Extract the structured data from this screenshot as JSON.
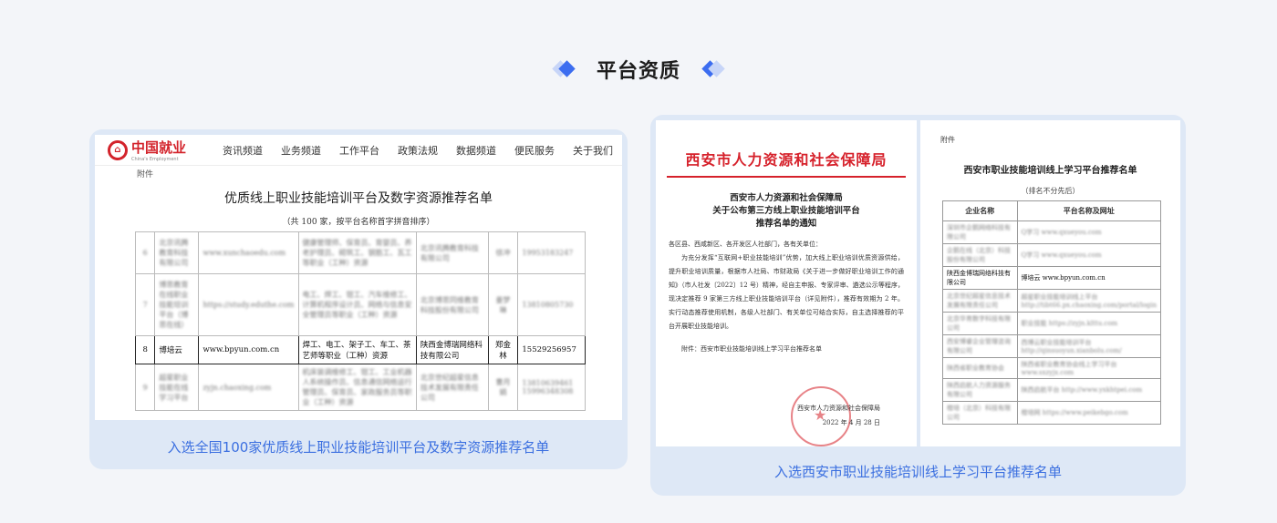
{
  "section": {
    "title": "平台资质"
  },
  "card1": {
    "nav": {
      "logo_text": "中国就业",
      "logo_sub": "China's Employment",
      "items": [
        "资讯频道",
        "业务频道",
        "工作平台",
        "政策法规",
        "数据频道",
        "便民服务",
        "关于我们"
      ]
    },
    "attachment": "附件",
    "doc_title": "优质线上职业技能培训平台及数字资源推荐名单",
    "doc_subtitle": "（共 100 家，按平台名称首字拼音排序）",
    "rows": [
      {
        "no": "6",
        "name": "北京讯腾教育科技有限公司",
        "url": "www.xunchaoedu.com",
        "jobs": "健康管理师、保育员、育婴员、养老护理员、砌筑工、钢筋工、瓦工等职业（工种）资源",
        "company": "北京讯腾教育科技有限公司",
        "contact": "徐冲",
        "tel": "19953183247",
        "blur": true
      },
      {
        "no": "7",
        "name": "博思教育在线职业技能培训平台（博思在线）",
        "url": "https://study.eduthe.com",
        "jobs": "电工、焊工、钳工、汽车维修工、计算机程序设计员、网络与信息安全管理员等职业（工种）资源",
        "company": "北京博思同维教育科技股份有限公司",
        "contact": "姜梦琳",
        "tel": "13810805730",
        "blur": true
      },
      {
        "no": "8",
        "name": "博培云",
        "url": "www.bpyun.com.cn",
        "jobs": "焊工、电工、架子工、车工、茶艺师等职业（工种）资源",
        "company": "陕西金博瑞网络科技有限公司",
        "contact": "郑金林",
        "tel": "15529256957",
        "blur": false
      },
      {
        "no": "9",
        "name": "超星职业技能在线学习平台",
        "url": "zyjn.chaoxing.com",
        "jobs": "机床装调维修工、钳工、工业机器人系统操作员、信息通信网络运行管理员、保育员、家政服务员等职业（工种）资源",
        "company": "北京世纪超星信息技术发展有限责任公司",
        "contact": "曹月娟",
        "tel": "13810639461 15996348308",
        "blur": true
      }
    ],
    "caption": "入选全国100家优质线上职业技能培训平台及数字资源推荐名单"
  },
  "card2": {
    "letterhead": "西安市人力资源和社会保障局",
    "notice_title": [
      "西安市人力资源和社会保障局",
      "关于公布第三方线上职业技能培训平台",
      "推荐名单的通知"
    ],
    "notice_body": [
      "各区县、西咸新区、各开发区人社部门，各有关单位：",
      "为充分发挥“互联网+职业技能培训”优势，加大线上职业培训优质资源供给，提升职业培训质量，根据市人社局、市财政局《关于进一步做好职业培训工作的通知》（市人社发〔2022〕12 号）精神，经自主申报、专家评审、遴选公示等程序，现决定推荐 9 家第三方线上职业技能培训平台（详见附件），推荐有效期为 2 年。实行动态推荐使用机制，各级人社部门、有关单位可结合实际，自主选择推荐的平台开展职业技能培训。"
    ],
    "notice_attachment": "附件：西安市职业技能培训线上学习平台推荐名单",
    "sign_org": "西安市人力资源和社会保障局",
    "sign_date": "2022 年 4 月 28 日",
    "attachment": "附件",
    "list_title": "西安市职业技能培训线上学习平台推荐名单",
    "list_subtitle": "（排名不分先后）",
    "list_headers": [
      "企业名称",
      "平台名称及网址"
    ],
    "list_rows": [
      {
        "company": "深圳市企鹅网络科技有限公司",
        "platform": "Q学习 www.qxueyou.com",
        "blur": true
      },
      {
        "company": "企鹅在线（北京）科技股份有限公司",
        "platform": "Q学习 www.qxueyou.com",
        "blur": true
      },
      {
        "company": "陕西金博瑞网络科技有限公司",
        "platform": "博培云 www.bpyun.com.cn",
        "blur": false
      },
      {
        "company": "北京世纪超星信息技术发展有限责任公司",
        "platform": "超星职业技能培训线上平台 http://tibt66.px.chaoxing.com/portal/login",
        "blur": true
      },
      {
        "company": "北京华育数字科技有限公司",
        "platform": "职业技能 https://zyjn.klttu.com",
        "blur": true
      },
      {
        "company": "西安博睿企业管理咨询有限公司",
        "platform": "西博云职业技能培训平台 http://qinsuoyun.xianbolu.com/",
        "blur": true
      },
      {
        "company": "陕西省职业教育协会",
        "platform": "陕西省职业教育协会线上学习平台 www.sxzyjx.com",
        "blur": true
      },
      {
        "company": "陕西启航人力资源服务有限公司",
        "platform": "陕西启航平台 http://www.yxkhtpei.com",
        "blur": true
      },
      {
        "company": "橙培（北京）科技有限公司",
        "platform": "橙培网 https://www.peikebgo.com",
        "blur": true
      }
    ],
    "caption": "入选西安市职业技能培训线上学习平台推荐名单"
  }
}
